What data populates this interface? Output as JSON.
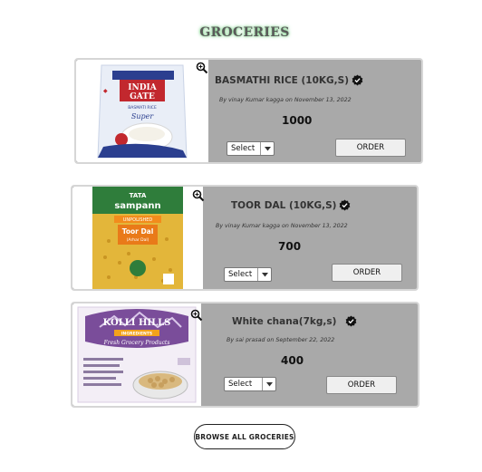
{
  "section": {
    "title": "GROCERIES"
  },
  "products": [
    {
      "name": "BASMATHI RICE (10KG,S)",
      "byline": "By vinay Kumar kagga on November 13, 2022",
      "price": "1000",
      "select_value": "Select",
      "order_label": "ORDER",
      "package_brand_line1": "INDIA",
      "package_brand_line2": "GATE",
      "package_subtitle": "BASMATI RICE",
      "package_variant": "Super"
    },
    {
      "name": "TOOR DAL (10KG,S)",
      "byline": "By vinay Kumar kagga on November 13, 2022",
      "price": "700",
      "select_value": "Select",
      "order_label": "ORDER",
      "package_brand_line1": "TATA",
      "package_brand_line2": "sampann",
      "package_tag": "UNPOLISHED",
      "package_product": "Toor Dal",
      "package_product_sub": "(Arhar Dal)"
    },
    {
      "name": "White chana(7kg,s)",
      "byline": "By sai prasad on September 22, 2022",
      "price": "400",
      "select_value": "Select",
      "order_label": "ORDER",
      "package_brand": "KOLLI HILLS",
      "package_tag": "INGREDIENTS",
      "package_tagline": "Fresh Grocery Products"
    }
  ],
  "browse_button": {
    "label": "BROWSE ALL GROCERIES"
  },
  "colors": {
    "card_bg": "#a9a9a9",
    "title_glow": "#7fd08a"
  }
}
